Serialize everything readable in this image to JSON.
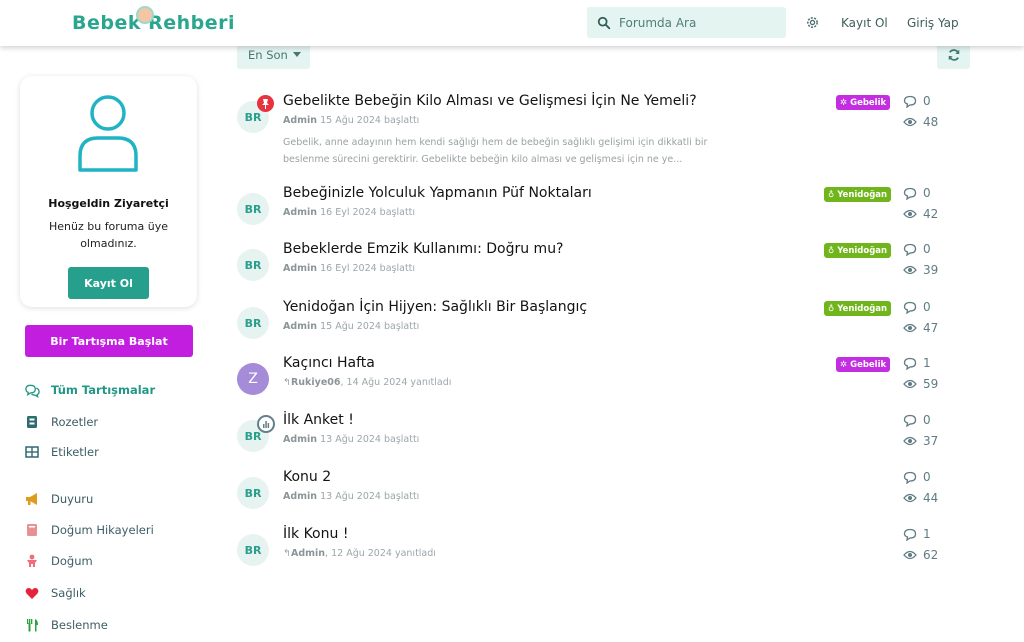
{
  "header": {
    "logo_text": "Bebek Rehberi",
    "search_placeholder": "Forumda Ara",
    "register_link": "Kayıt Ol",
    "login_link": "Giriş Yap"
  },
  "toolbar": {
    "sort_label": "En Son"
  },
  "sidebar": {
    "welcome_title": "Hoşgeldin Ziyaretçi",
    "welcome_text": "Henüz bu foruma üye olmadınız.",
    "register_button": "Kayıt Ol",
    "start_discussion_button": "Bir Tartışma Başlat",
    "nav": [
      {
        "label": "Tüm Tartışmalar",
        "icon": "comments-icon"
      },
      {
        "label": "Rozetler",
        "icon": "badge-icon"
      },
      {
        "label": "Etiketler",
        "icon": "tags-grid-icon"
      },
      {
        "label": "Duyuru",
        "icon": "megaphone-icon"
      },
      {
        "label": "Doğum Hikayeleri",
        "icon": "book-icon"
      },
      {
        "label": "Doğum",
        "icon": "baby-icon"
      },
      {
        "label": "Sağlık",
        "icon": "heart-icon"
      },
      {
        "label": "Beslenme",
        "icon": "utensils-icon"
      }
    ]
  },
  "discussions": [
    {
      "title": "Gebelikte Bebeğin Kilo Alması ve Gelişmesi İçin Ne Yemeli?",
      "author": "Admin",
      "meta": " 15 Ağu 2024 başlattı",
      "excerpt": "Gebelik, anne adayının hem kendi sağlığı hem de bebeğin sağlıklı gelişimi için dikkatli bir beslenme sürecini gerektirir. Gebelikte bebeğin kilo alması ve gelişmesi için ne ye...",
      "tag": "Gebelik",
      "replies": "0",
      "views": "48"
    },
    {
      "title": "Bebeğinizle Yolculuk Yapmanın Püf Noktaları",
      "author": "Admin",
      "meta": " 16 Eyl 2024 başlattı",
      "tag": "Yenidoğan",
      "replies": "0",
      "views": "42"
    },
    {
      "title": "Bebeklerde Emzik Kullanımı: Doğru mu?",
      "author": "Admin",
      "meta": " 16 Eyl 2024 başlattı",
      "tag": "Yenidoğan",
      "replies": "0",
      "views": "39"
    },
    {
      "title": "Yenidoğan İçin Hijyen: Sağlıklı Bir Başlangıç",
      "author": "Admin",
      "meta": " 15 Ağu 2024 başlattı",
      "tag": "Yenidoğan",
      "replies": "0",
      "views": "47"
    },
    {
      "title": "Kaçıncı Hafta",
      "author": "Rukiye06",
      "meta": ", 14 Ağu 2024 yanıtladı",
      "tag": "Gebelik",
      "replies": "1",
      "views": "59",
      "avatar_letter": "Z"
    },
    {
      "title": "İlk Anket !",
      "author": "Admin",
      "meta": " 13 Ağu 2024 başlattı",
      "replies": "0",
      "views": "37"
    },
    {
      "title": "Konu 2",
      "author": "Admin",
      "meta": " 13 Ağu 2024 başlattı",
      "replies": "0",
      "views": "44"
    },
    {
      "title": "İlk Konu !",
      "author": "Admin",
      "meta": ", 12 Ağu 2024 yanıtladı",
      "replies": "1",
      "views": "62"
    }
  ],
  "avatar_initials": "BR",
  "colors": {
    "accent": "#26a08d",
    "start_button": "#c21ee0",
    "tag_gebelik": "#c22ee0",
    "tag_yenidogan": "#70b51b",
    "pin": "#e6333f"
  }
}
